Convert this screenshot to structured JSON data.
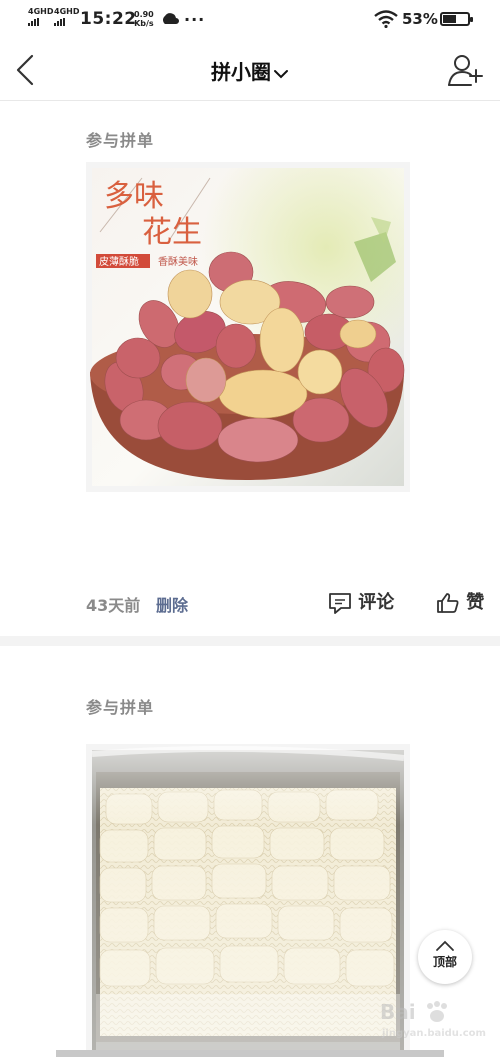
{
  "status_bar": {
    "signal1": "4GHD",
    "signal2": "4GHD",
    "time": "15:22",
    "speed_value": "0.90",
    "speed_unit": "Kb/s",
    "dots": "···",
    "battery": "53%",
    "battery_level": 0.53
  },
  "nav": {
    "title": "拼小圈",
    "icons": [
      "back-icon",
      "chevron-down-icon",
      "add-friend-icon"
    ]
  },
  "posts": [
    {
      "label": "参与拼单",
      "image": {
        "title_line1": "多味",
        "title_line2": "花生",
        "tag1": "皮薄酥脆",
        "tag2": "香酥美味"
      },
      "time_ago": "43天前",
      "delete": "删除",
      "comment": "评论",
      "like": "赞"
    },
    {
      "label": "参与拼单"
    }
  ],
  "top_button": "顶部",
  "watermark": {
    "brand": "Bai",
    "site": "jingyan.baidu.com"
  },
  "colors": {
    "label_gray": "#8a8a8a",
    "delete_blue": "#5c6c90",
    "divider": "#f3f3f3"
  }
}
